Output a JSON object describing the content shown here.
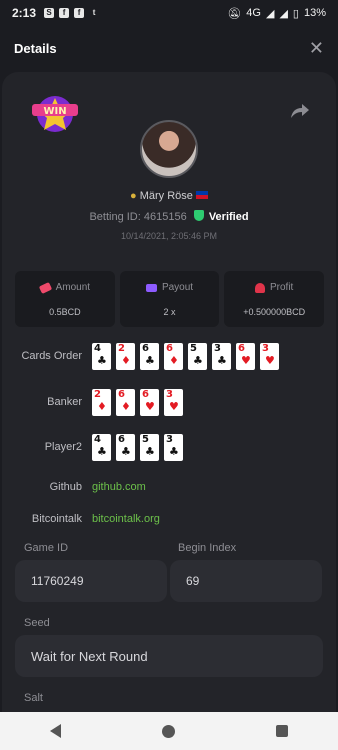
{
  "statusbar": {
    "time": "2:13",
    "network": "4G",
    "battery": "13%"
  },
  "header": {
    "title": "Details",
    "close": "✕"
  },
  "badge_text": "WIN",
  "user": {
    "name": "Märy Röse",
    "betting_id_label": "Betting ID:",
    "betting_id": "4615156",
    "verified": "Verified",
    "datetime": "10/14/2021, 2:05:46 PM"
  },
  "stats": [
    {
      "label": "Amount",
      "value": "0.5BCD"
    },
    {
      "label": "Payout",
      "value": "2 x"
    },
    {
      "label": "Profit",
      "value": "+0.500000BCD"
    }
  ],
  "cards_order": {
    "label": "Cards Order",
    "cards": [
      {
        "rank": "4",
        "suit": "♣",
        "color": "black"
      },
      {
        "rank": "2",
        "suit": "♦",
        "color": "red"
      },
      {
        "rank": "6",
        "suit": "♣",
        "color": "black"
      },
      {
        "rank": "6",
        "suit": "♦",
        "color": "red"
      },
      {
        "rank": "5",
        "suit": "♣",
        "color": "black"
      },
      {
        "rank": "3",
        "suit": "♣",
        "color": "black"
      },
      {
        "rank": "6",
        "suit": "♥",
        "color": "red"
      },
      {
        "rank": "3",
        "suit": "♥",
        "color": "red"
      }
    ]
  },
  "banker": {
    "label": "Banker",
    "cards": [
      {
        "rank": "2",
        "suit": "♦",
        "color": "red"
      },
      {
        "rank": "6",
        "suit": "♦",
        "color": "red"
      },
      {
        "rank": "6",
        "suit": "♥",
        "color": "red"
      },
      {
        "rank": "3",
        "suit": "♥",
        "color": "red"
      }
    ]
  },
  "player2": {
    "label": "Player2",
    "cards": [
      {
        "rank": "4",
        "suit": "♣",
        "color": "black"
      },
      {
        "rank": "6",
        "suit": "♣",
        "color": "black"
      },
      {
        "rank": "5",
        "suit": "♣",
        "color": "black"
      },
      {
        "rank": "3",
        "suit": "♣",
        "color": "black"
      }
    ]
  },
  "github": {
    "label": "Github",
    "link": "github.com"
  },
  "bitcointalk": {
    "label": "Bitcointalk",
    "link": "bitcointalk.org"
  },
  "fields": {
    "game_id_label": "Game ID",
    "game_id": "11760249",
    "begin_index_label": "Begin Index",
    "begin_index": "69",
    "seed_label": "Seed",
    "seed": "Wait for Next Round",
    "salt_label": "Salt"
  },
  "colors": {
    "accent_green": "#6cc04a",
    "verified_green": "#2ecc71",
    "panel": "#232429",
    "background": "#1b1c21"
  },
  "icons": [
    "location-pin-icon",
    "philippines-flag-icon",
    "shield-check-icon",
    "share-icon",
    "close-icon",
    "amount-icon",
    "payout-icon",
    "profit-icon"
  ]
}
